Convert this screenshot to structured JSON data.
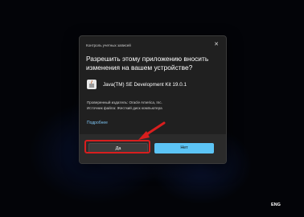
{
  "dialog": {
    "window_title": "Контроль учетных записей",
    "close_glyph": "✕",
    "question": "Разрешить этому приложению вносить изменения на вашем устройстве?",
    "app": {
      "icon": "java-installer-icon",
      "name": "Java(TM) SE Development Kit 19.0.1"
    },
    "publisher": "Проверенный издатель: Oracle America, Inc.",
    "origin": "Источник файла: Жесткий диск компьютера",
    "more_details_link": "Подробнее",
    "buttons": {
      "yes": "Да",
      "no": "Нет"
    },
    "accent_color": "#5cc4f5"
  },
  "annotation": {
    "highlight_color": "#d81e1e",
    "target": "yes"
  },
  "taskbar": {
    "language": "ENG"
  }
}
